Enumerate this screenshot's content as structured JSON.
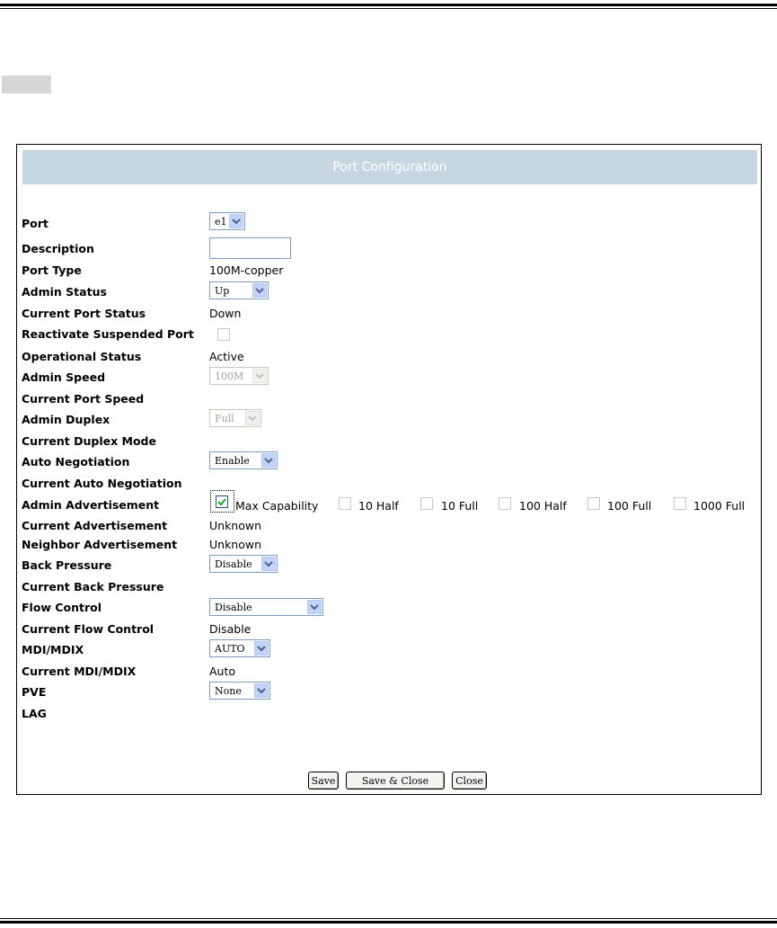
{
  "panel": {
    "title": "Port Configuration"
  },
  "fields": {
    "port": {
      "label": "Port",
      "value": "e1"
    },
    "description": {
      "label": "Description",
      "value": ""
    },
    "port_type": {
      "label": "Port Type",
      "value": "100M-copper"
    },
    "admin_status": {
      "label": "Admin Status",
      "value": "Up"
    },
    "current_port_status": {
      "label": "Current Port Status",
      "value": "Down"
    },
    "reactivate": {
      "label": "Reactivate Suspended Port"
    },
    "operational_status": {
      "label": "Operational Status",
      "value": "Active"
    },
    "admin_speed": {
      "label": "Admin Speed",
      "value": "100M"
    },
    "current_port_speed": {
      "label": "Current Port Speed",
      "value": ""
    },
    "admin_duplex": {
      "label": "Admin Duplex",
      "value": "Full"
    },
    "current_duplex_mode": {
      "label": "Current Duplex Mode",
      "value": ""
    },
    "auto_negotiation": {
      "label": "Auto Negotiation",
      "value": "Enable"
    },
    "current_auto_negotiation": {
      "label": "Current Auto Negotiation",
      "value": ""
    },
    "admin_advertisement": {
      "label": "Admin Advertisement",
      "options": [
        "Max Capability",
        "10 Half",
        "10 Full",
        "100 Half",
        "100 Full",
        "1000 Full"
      ],
      "checked": "Max Capability"
    },
    "current_advertisement": {
      "label": "Current Advertisement",
      "value": "Unknown"
    },
    "neighbor_advertisement": {
      "label": "Neighbor Advertisement",
      "value": "Unknown"
    },
    "back_pressure": {
      "label": "Back Pressure",
      "value": "Disable"
    },
    "current_back_pressure": {
      "label": "Current Back Pressure",
      "value": ""
    },
    "flow_control": {
      "label": "Flow Control",
      "value": "Disable"
    },
    "current_flow_control": {
      "label": "Current Flow Control",
      "value": "Disable"
    },
    "mdi_mdix": {
      "label": "MDI/MDIX",
      "value": "AUTO"
    },
    "current_mdi_mdix": {
      "label": "Current MDI/MDIX",
      "value": "Auto"
    },
    "pve": {
      "label": "PVE",
      "value": "None"
    },
    "lag": {
      "label": "LAG",
      "value": ""
    }
  },
  "buttons": {
    "save": "Save",
    "save_close": "Save & Close",
    "close": "Close"
  },
  "colors": {
    "title_bar": "#c6d6e0",
    "select_border": "#7f9db9",
    "dropdown_arrow_bg": "#c1d3fb",
    "checkmark": "#21a121"
  },
  "icons": {
    "dropdown": "chevron-down-icon",
    "check": "checkmark-icon"
  }
}
